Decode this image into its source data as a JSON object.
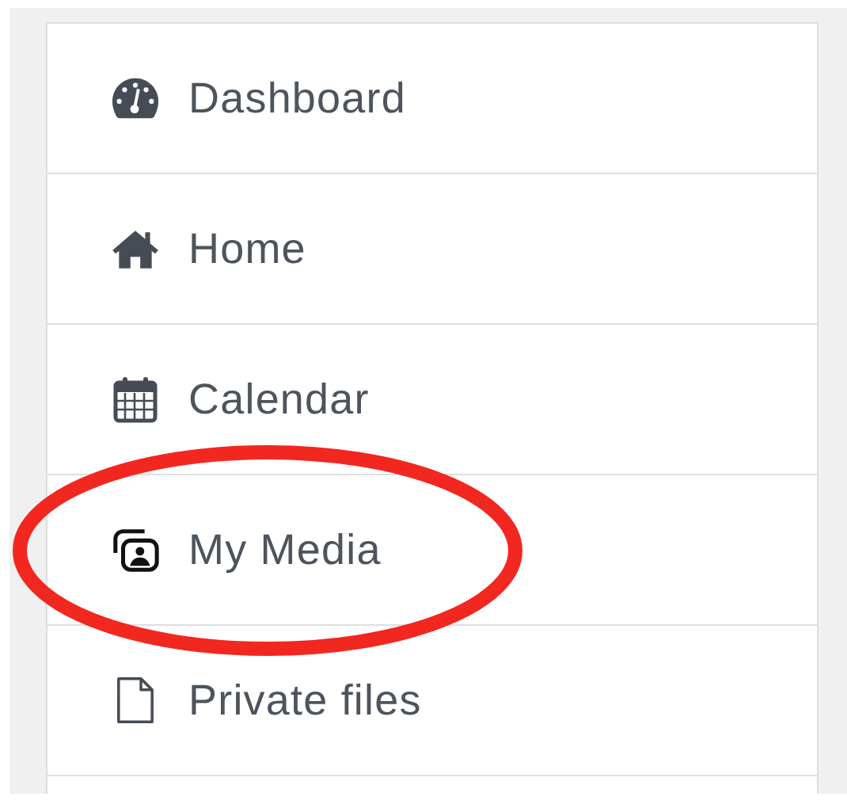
{
  "nav": {
    "items": [
      {
        "kind": "dashboard",
        "label": "Dashboard",
        "circled": false
      },
      {
        "kind": "home",
        "label": "Home",
        "circled": false
      },
      {
        "kind": "calendar",
        "label": "Calendar",
        "circled": false
      },
      {
        "kind": "media",
        "label": "My Media",
        "circled": true
      },
      {
        "kind": "file",
        "label": "Private files",
        "circled": false
      }
    ]
  }
}
